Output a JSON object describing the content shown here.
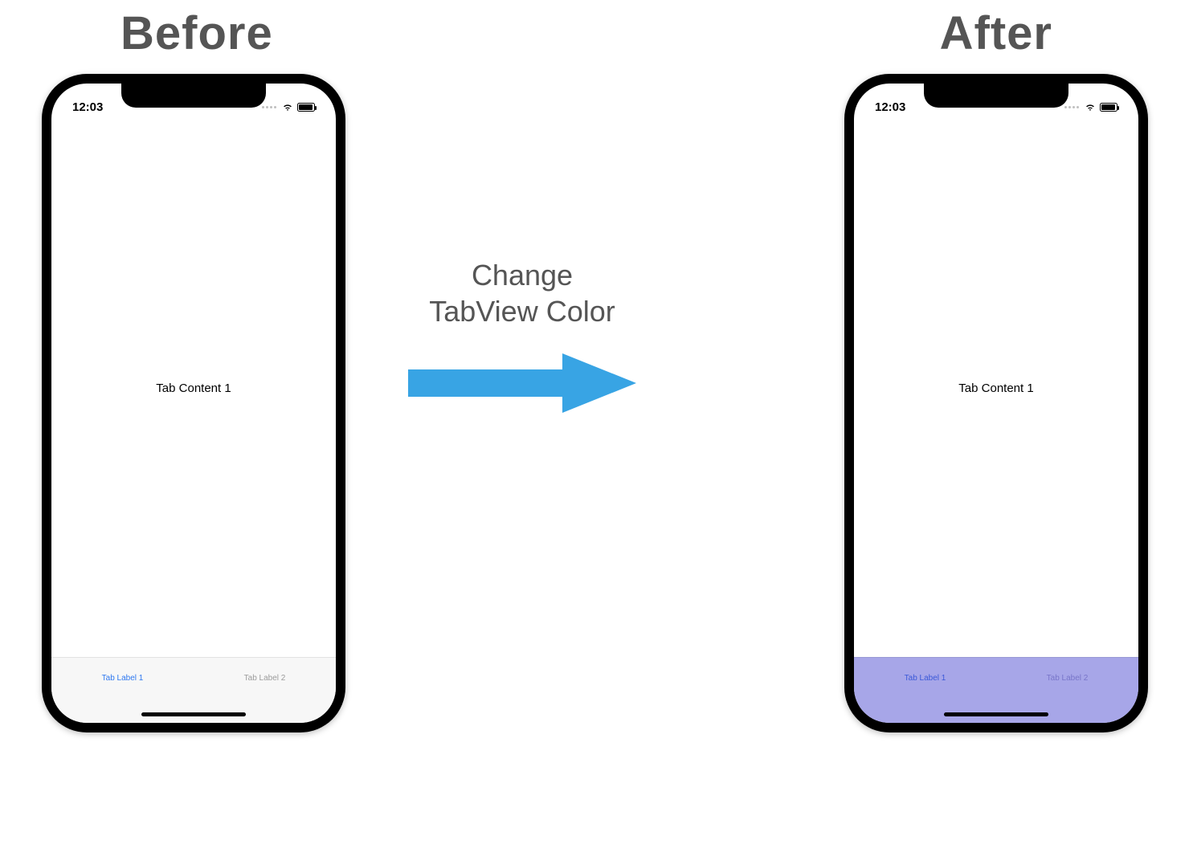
{
  "headings": {
    "before": "Before",
    "after": "After"
  },
  "center": {
    "line1": "Change",
    "line2": "TabView Color"
  },
  "colors": {
    "arrow": "#38a4e4",
    "heading_text": "#555555",
    "tabbar_default": "#f7f7f7",
    "tabbar_tinted": "#a7a6e8",
    "tab_active": "#2f78f0",
    "tab_inactive": "#9b9b9b"
  },
  "phone_before": {
    "status_time": "12:03",
    "content": "Tab Content 1",
    "tabbar_style": "default",
    "tabs": [
      {
        "label": "Tab Label 1",
        "active": true
      },
      {
        "label": "Tab Label 2",
        "active": false
      }
    ]
  },
  "phone_after": {
    "status_time": "12:03",
    "content": "Tab Content 1",
    "tabbar_style": "tinted",
    "tabs": [
      {
        "label": "Tab Label 1",
        "active": true
      },
      {
        "label": "Tab Label 2",
        "active": false
      }
    ]
  }
}
